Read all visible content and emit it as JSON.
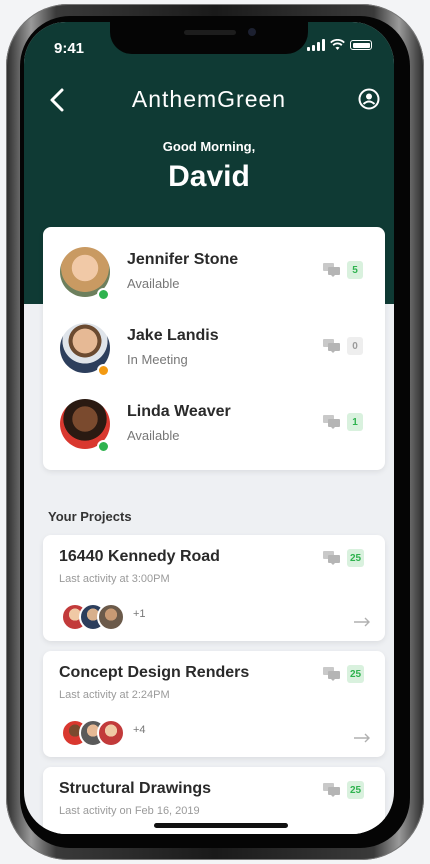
{
  "status_bar": {
    "time": "9:41"
  },
  "header": {
    "app_title": "AnthemGreen",
    "greeting": "Good Morning,",
    "user_name": "David"
  },
  "contacts": [
    {
      "name": "Jennifer Stone",
      "status": "Available",
      "presence_color": "#2fb34f",
      "message_count": "5",
      "badge_bg": "#d9f1de",
      "badge_fg": "#2fb34f"
    },
    {
      "name": "Jake Landis",
      "status": "In Meeting",
      "presence_color": "#f39a12",
      "message_count": "0",
      "badge_bg": "#eeeeee",
      "badge_fg": "#9b9b9b"
    },
    {
      "name": "Linda Weaver",
      "status": "Available",
      "presence_color": "#2fb34f",
      "message_count": "1",
      "badge_bg": "#d9f1de",
      "badge_fg": "#2fb34f"
    }
  ],
  "projects_section": {
    "label": "Your Projects"
  },
  "projects": [
    {
      "title": "16440 Kennedy Road",
      "activity": "Last activity at 3:00PM",
      "message_count": "25",
      "extra_members": "+1"
    },
    {
      "title": "Concept Design Renders",
      "activity": "Last activity at 2:24PM",
      "message_count": "25",
      "extra_members": "+4"
    },
    {
      "title": "Structural Drawings",
      "activity": "Last activity on Feb 16, 2019",
      "message_count": "25",
      "extra_members": ""
    }
  ],
  "colors": {
    "header_bg": "#0f3a34",
    "badge_green_bg": "#d9f1de",
    "badge_green_fg": "#2fb34f"
  },
  "icons": [
    "back-chevron-icon",
    "profile-icon",
    "chat-icon",
    "arrow-right-icon",
    "signal-icon",
    "wifi-icon",
    "battery-icon"
  ]
}
